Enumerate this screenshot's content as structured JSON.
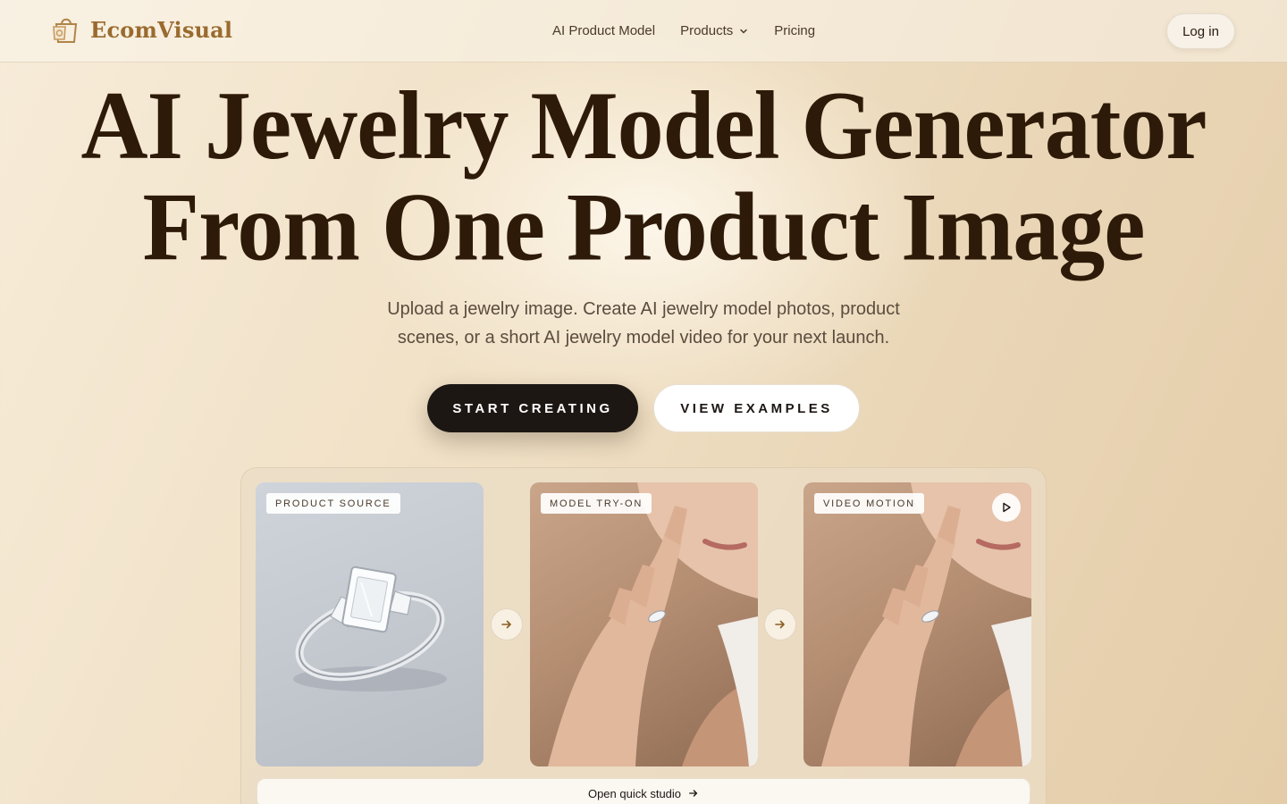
{
  "brand": {
    "name": "EcomVisual",
    "logo_icon": "shopping-bag-logo-icon",
    "accent": "#9a6b2f"
  },
  "nav": {
    "items": [
      {
        "label": "AI Product Model"
      },
      {
        "label": "Products",
        "icon": "chevron-down-icon"
      },
      {
        "label": "Pricing"
      }
    ],
    "login_label": "Log in"
  },
  "hero": {
    "title_line1": "AI Jewelry Model Generator",
    "title_line2": "From One Product Image",
    "subtitle_line1": "Upload a jewelry image. Create AI jewelry model photos, product",
    "subtitle_line2": "scenes, or a short AI jewelry model video for your next launch.",
    "primary_cta": "START CREATING",
    "secondary_cta": "VIEW EXAMPLES"
  },
  "showcase": {
    "cards": [
      {
        "label": "PRODUCT SOURCE"
      },
      {
        "label": "MODEL TRY-ON"
      },
      {
        "label": "VIDEO MOTION",
        "icon": "play-icon"
      }
    ],
    "arrow_icon": "arrow-right-icon",
    "studio_label": "Open quick studio"
  },
  "colors": {
    "background": "#f1e2c8",
    "title": "#2e1a08",
    "primary_button": "#1d1714",
    "secondary_button": "#ffffff"
  }
}
